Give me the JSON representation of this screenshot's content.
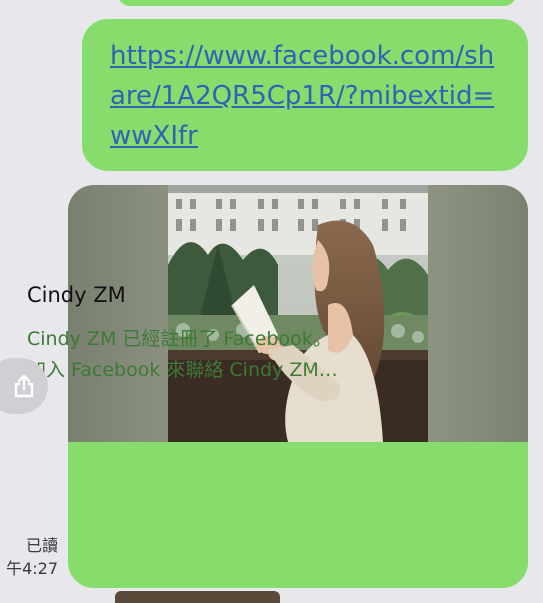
{
  "message": {
    "link_url": "https://www.facebook.com/share/1A2QR5Cp1R/?mibextid=wwXIfr"
  },
  "link_preview": {
    "title": "Cindy ZM",
    "description_line1": "Cindy ZM 已經註冊了 Facebook。",
    "description_line2": "加入 Facebook 來聯絡 Cindy ZM…"
  },
  "status": {
    "read_label": "已讀",
    "time": "午4:27"
  },
  "share_button": {
    "icon": "share-icon"
  },
  "colors": {
    "bubble_green": "#86dd6c",
    "link_blue": "#2e63b8",
    "desc_green": "#3d7a35",
    "background": "#e7e7ec"
  }
}
